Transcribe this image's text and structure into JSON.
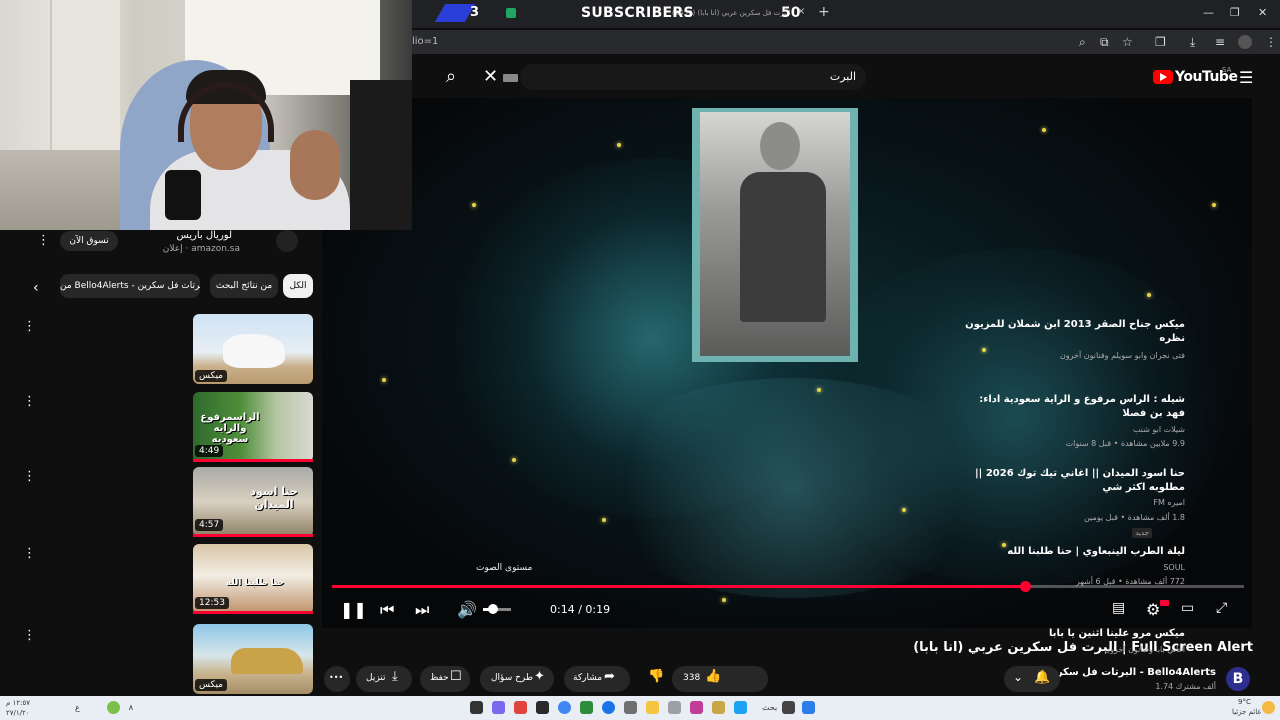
{
  "browser": {
    "tab_count": "3",
    "subscribers_label": "SUBSCRIBERS",
    "subscribers_count": "50",
    "tab_title": "(2452) البرت فل سكرين عربي (انا بابا)",
    "url": "lio=1",
    "tab_close": "×",
    "new_tab": "+",
    "win_min": "—",
    "win_max": "❐",
    "win_close": "✕"
  },
  "youtube": {
    "search_query": "البرت",
    "logo_text": "YouTube",
    "country": "SA",
    "icons": {
      "search": "search-icon",
      "clear": "close-icon",
      "menu": "menu-icon"
    }
  },
  "player": {
    "volume_tooltip": "مستوى الصوت",
    "time": "0:14 / 0:19",
    "progress": 0.76,
    "volume": 0.35,
    "icons": [
      "pause-icon",
      "previous-icon",
      "next-icon",
      "volume-icon",
      "subtitles-icon",
      "settings-icon",
      "theater-icon",
      "fullscreen-icon"
    ]
  },
  "video": {
    "title": "البرت فل سكرين عربي (انا بابا) | Full Screen Alert",
    "channel_name": "البرتات فل سكرين - Bello4Alerts",
    "channel_avatar": "B",
    "subscribers": "1.74 ألف مشترك",
    "likes": "338",
    "share": "مشاركة",
    "ask": "طرح سؤال",
    "save": "حفظ",
    "download": "تنزيل",
    "more": "•••"
  },
  "sidebar": {
    "ad": {
      "title": "لوريال باريس",
      "sub": "إعلان · amazon.sa",
      "shop_button": "تسوق الآن"
    },
    "chips": [
      {
        "label": "الكل",
        "active": true
      },
      {
        "label": "من نتائج البحث",
        "active": false
      },
      {
        "label": "من Bello4Alerts - البرتات فل سكرين",
        "active": false
      }
    ],
    "recommendations": [
      {
        "title": "ميكس جناح الصقر 2013 ابن شملان للمزيون نظره",
        "meta1": "فتى نجران وابو سويلم وفنانون آخرون",
        "meta2": "",
        "badge": "ميكس",
        "thumb_text": ""
      },
      {
        "title": "شيله : الراس مرفوع و الراية سعودية اداء: فهد بن فصلا",
        "meta1": "شيلات ابو شنب",
        "meta2": "9.9 ملايين مشاهدة • قبل 8 سنوات",
        "badge": "4:49",
        "thumb_text": "الراسمرفوع والرايه سعوديه"
      },
      {
        "title": "حنا اسود الميدان || اغاني تيك توك 2026 || مطلوبه اكثر شي",
        "meta1": "اميره FM",
        "meta2": "1.8 ألف مشاهدة • قبل يومين",
        "badge": "4:57",
        "thumb_text": "حنا اسود الميدان",
        "tag": "جديد"
      },
      {
        "title": "ليلة الطرب الينبعاوي | حنا طلبنا الله",
        "meta1": "SOUL",
        "meta2": "772 ألف مشاهدة • قبل 6 أشهر",
        "badge": "12:53",
        "thumb_text": "حنا طلبنا الله"
      },
      {
        "title": "ميكس مرو علينا اثنين يا بابا",
        "meta1": "اغاني بابا وفنانون آخرون",
        "meta2": "",
        "badge": "ميكس",
        "thumb_text": ""
      }
    ]
  },
  "taskbar": {
    "clock": "١٢:٥٧ م",
    "date": "٢٧/١/٢٠",
    "lang": "ع",
    "search": "بحث",
    "weather": "9°C",
    "weather_sub": "غائم جزئيا"
  }
}
